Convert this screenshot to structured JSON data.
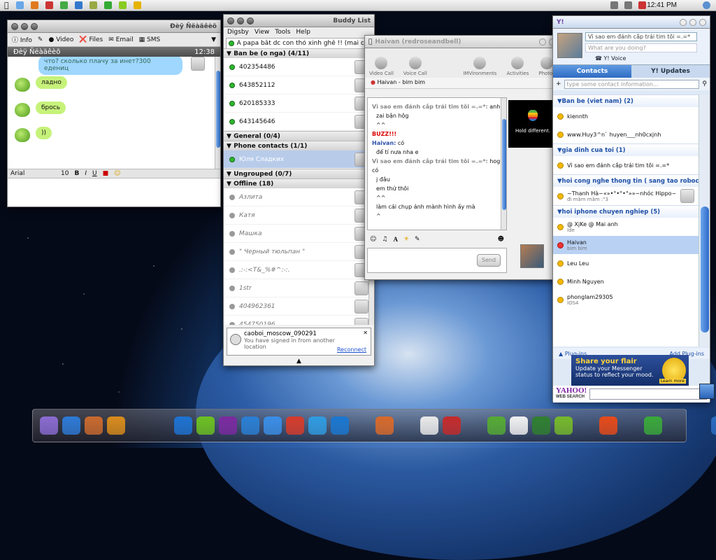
{
  "menubar": {
    "clock": "12:41 PM"
  },
  "chat1": {
    "title": "Ðèÿ Ñëàäêèõ",
    "toolbar": {
      "info": "Info",
      "video": "Video",
      "files": "Files",
      "email": "Email",
      "sms": "SMS"
    },
    "header_name": "Ðèÿ Ñëàäêèõ",
    "header_time": "12:38",
    "messages": [
      "что? сколько плачу за инет?300 едениц",
      "ладно",
      "брось",
      "))"
    ],
    "font": "Arial",
    "font_size": "10"
  },
  "buddylist": {
    "title": "Buddy List",
    "menu": [
      "Digsby",
      "View",
      "Tools",
      "Help"
    ],
    "status": "A papa bắt dc con thỏ xinh ghê !! (mai cho...",
    "groups": {
      "g1": "Ban be (o nga) (4/11)",
      "g2": "General (0/4)",
      "g3": "Phone contacts (1/1)",
      "g4": "Ungrouped (0/7)",
      "g5": "Offline (18)"
    },
    "online": [
      "402354486",
      "643852112",
      "620185333",
      "643145646"
    ],
    "phone": "Юля Сладких",
    "offline": [
      "Азлита",
      "Катя",
      "Машка",
      "\" Черный тюльпан \"",
      ".:-:<T&_%#^:-:.",
      "1str",
      "404962361",
      "454750196"
    ],
    "notification": {
      "name": "caoboi_moscow_090291",
      "text": "You have signed in from another location",
      "link": "Reconnect"
    }
  },
  "chat2": {
    "title": "Haivan (redroseandbell)",
    "tools": {
      "video_call": "Video Call",
      "voice_call": "Voice Call",
      "imv": "IMVironments",
      "activities": "Activities",
      "photos": "Photos"
    },
    "status": "Haivan - bim bim",
    "messages": {
      "s1": "Vì sao em đánh cắp trái tim tôi =.=*:",
      "m1a": "anh",
      "m1b": "zai bận hộg",
      "m1c": "^^",
      "buzz": "BUZZ!!!",
      "h_name": "Haivan:",
      "h_text": "có",
      "h2": "để tí nưa nha e",
      "s2": "Vì sao em đánh cắp trái tim tôi =.=*:",
      "m2a": "hog có",
      "m2b": "j đâu",
      "m2c": "em thử thôi",
      "m2d": "^^",
      "m2e": "làm cái chụp ảnh mành hình ấy mà",
      "m2f": "^"
    },
    "ad": "Hold different.",
    "send": "Send"
  },
  "yahoo": {
    "status_msg": "Vì sao em đánh cắp trái tim tôi =.=*",
    "what_doing": "What are you doing?",
    "voice": "Y! Voice",
    "tab_contacts": "Contacts",
    "tab_updates": "Y! Updates",
    "search_placeholder": "type some contact information...",
    "groups": {
      "g1": "Ban be (viet nam) (2)",
      "g2": "gia dinh cua toi (1)",
      "g3": "hoi cong nghe thong tin ( sang tao robocon ) (...",
      "g4": "hoi iphone chuyen nghiep (5)"
    },
    "contacts": {
      "c1": "kiennth",
      "c2": "www.Huy3^n` huyen___nh0cxjnh",
      "c3": "Vì sao em đánh cắp trái tim tôi =.=*",
      "c4": "~Thanh Hà~«»•°•°•°»»~nhóc Hippo~...",
      "c4s": "đi mâm mâm :\"3",
      "c5": "@ XjKe @ Mai anh",
      "c5s": "Ide",
      "c6": "Haivan",
      "c6s": "bim bim",
      "c7": "Leu Leu",
      "c8": "Minh Nguyen",
      "c9": "phonglam29305",
      "c9s": "IOS4"
    },
    "plugins": "Plug-ins",
    "add_plugins": "Add Plug-ins",
    "ad_title": "Share your flair",
    "ad_text": "Update your Messenger status to reflect your mood.",
    "ad_button": "Learn more",
    "logo": "YAHOO!",
    "logo_sub": "WEB SEARCH"
  },
  "dock": {
    "colors": [
      "#8a6bd1",
      "#2e7ad6",
      "#c96a2f",
      "#d98c1c",
      "#444",
      "#ccc",
      "#1e73d2",
      "#6cc020",
      "#7b2aa0",
      "#2a7fd4",
      "#3a8ee6",
      "#d63b2b",
      "#2f9be0",
      "#1a77d0",
      "#eee",
      "#d8692a",
      "#333",
      "#e9e9e9",
      "#c42a2a",
      "#ddd",
      "#55aa33",
      "#f0f0f0",
      "#2f7f2f",
      "#76b82a",
      "#333",
      "#e64a19",
      "#555",
      "#3aa83a",
      "#222",
      "#ddd",
      "#2b6dc2"
    ]
  }
}
